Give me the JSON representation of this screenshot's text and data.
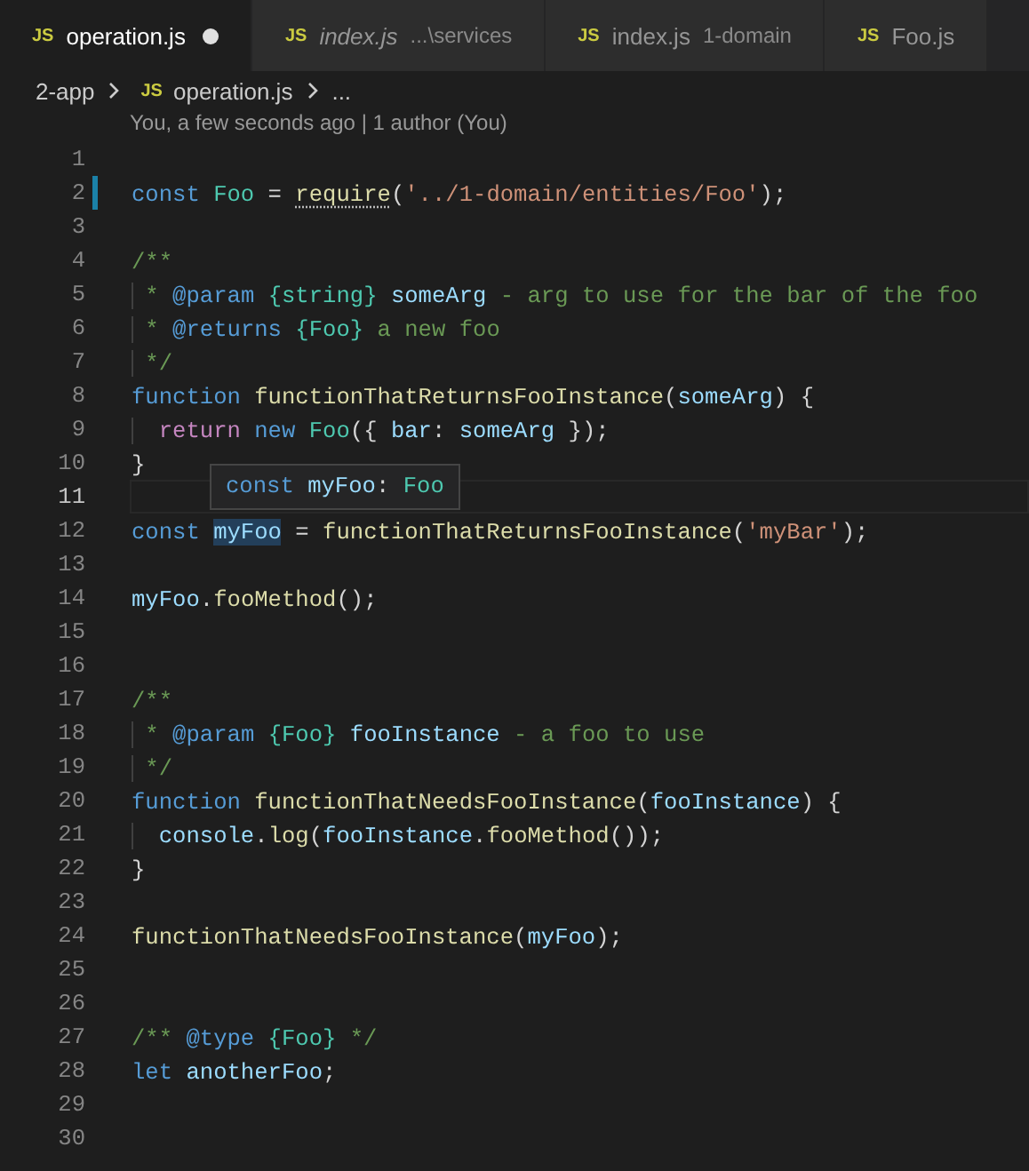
{
  "tabs": [
    {
      "icon": "JS",
      "label": "operation.js",
      "kind": "pinned",
      "selected": true,
      "dirty": true
    },
    {
      "icon": "JS",
      "label": "index.js",
      "description": "...\\services",
      "kind": "preview",
      "selected": false,
      "dirty": false
    },
    {
      "icon": "JS",
      "label": "index.js",
      "description": "1-domain",
      "kind": "pinned",
      "selected": false,
      "dirty": false
    },
    {
      "icon": "JS",
      "label": "Foo.js",
      "kind": "pinned",
      "selected": false,
      "dirty": false
    }
  ],
  "breadcrumb": [
    {
      "kind": "folder",
      "label": "2-app"
    },
    {
      "kind": "file",
      "icon": "JS",
      "label": "operation.js"
    },
    {
      "kind": "more",
      "label": "..."
    }
  ],
  "codelens": "You, a few seconds ago | 1 author (You)",
  "lines": [
    {
      "number": "1",
      "modified": false,
      "current": false
    },
    {
      "number": "2",
      "modified": true,
      "current": false,
      "tokens": [
        {
          "text": "const ",
          "kind": "keyword"
        },
        {
          "text": "Foo",
          "kind": "type"
        },
        {
          "text": " = ",
          "kind": "plain"
        },
        {
          "text": "require",
          "kind": "function",
          "suggestion": true
        },
        {
          "text": "(",
          "kind": "plain"
        },
        {
          "text": "'../1-domain/entities/Foo'",
          "kind": "string"
        },
        {
          "text": ");",
          "kind": "plain"
        }
      ]
    },
    {
      "number": "3",
      "modified": false,
      "current": false
    },
    {
      "number": "4",
      "modified": false,
      "current": false,
      "tokens": [
        {
          "text": "/**",
          "kind": "comment"
        }
      ]
    },
    {
      "number": "5",
      "modified": false,
      "current": false,
      "tokens": [
        {
          "text": " * ",
          "kind": "comment"
        },
        {
          "text": "@param ",
          "kind": "tag"
        },
        {
          "text": "{string} ",
          "kind": "type"
        },
        {
          "text": "someArg",
          "kind": "variable"
        },
        {
          "text": " - arg to use for the bar of the foo",
          "kind": "comment"
        }
      ]
    },
    {
      "number": "6",
      "modified": false,
      "current": false,
      "tokens": [
        {
          "text": " * ",
          "kind": "comment"
        },
        {
          "text": "@returns ",
          "kind": "tag"
        },
        {
          "text": "{Foo}",
          "kind": "type"
        },
        {
          "text": " a new foo",
          "kind": "comment"
        }
      ]
    },
    {
      "number": "7",
      "modified": false,
      "current": false,
      "tokens": [
        {
          "text": " */",
          "kind": "comment"
        }
      ]
    },
    {
      "number": "8",
      "modified": false,
      "current": false,
      "tokens": [
        {
          "text": "function ",
          "kind": "keyword"
        },
        {
          "text": "functionThatReturnsFooInstance",
          "kind": "function"
        },
        {
          "text": "(",
          "kind": "plain"
        },
        {
          "text": "someArg",
          "kind": "variable"
        },
        {
          "text": ") {",
          "kind": "plain"
        }
      ]
    },
    {
      "number": "9",
      "modified": false,
      "current": false,
      "tokens": [
        {
          "text": "  return ",
          "kind": "control"
        },
        {
          "text": "new ",
          "kind": "keyword"
        },
        {
          "text": "Foo",
          "kind": "type"
        },
        {
          "text": "({ ",
          "kind": "plain"
        },
        {
          "text": "bar",
          "kind": "variable"
        },
        {
          "text": ": ",
          "kind": "plain"
        },
        {
          "text": "someArg",
          "kind": "variable"
        },
        {
          "text": " });",
          "kind": "plain"
        }
      ]
    },
    {
      "number": "10",
      "modified": false,
      "current": false,
      "tokens": [
        {
          "text": "}",
          "kind": "plain"
        }
      ]
    },
    {
      "number": "11",
      "modified": false,
      "current": true,
      "hover": [
        {
          "text": "const ",
          "kind": "keyword"
        },
        {
          "text": "myFoo",
          "kind": "variable"
        },
        {
          "text": ": ",
          "kind": "plain"
        },
        {
          "text": "Foo",
          "kind": "type"
        }
      ]
    },
    {
      "number": "12",
      "modified": false,
      "current": false,
      "tokens": [
        {
          "text": "const ",
          "kind": "keyword"
        },
        {
          "text": "myFoo",
          "kind": "variable",
          "highlighted": true
        },
        {
          "text": " = ",
          "kind": "plain"
        },
        {
          "text": "functionThatReturnsFooInstance",
          "kind": "function"
        },
        {
          "text": "(",
          "kind": "plain"
        },
        {
          "text": "'myBar'",
          "kind": "string"
        },
        {
          "text": ");",
          "kind": "plain"
        }
      ]
    },
    {
      "number": "13",
      "modified": false,
      "current": false
    },
    {
      "number": "14",
      "modified": false,
      "current": false,
      "tokens": [
        {
          "text": "myFoo",
          "kind": "variable"
        },
        {
          "text": ".",
          "kind": "plain"
        },
        {
          "text": "fooMethod",
          "kind": "function"
        },
        {
          "text": "();",
          "kind": "plain"
        }
      ]
    },
    {
      "number": "15",
      "modified": false,
      "current": false
    },
    {
      "number": "16",
      "modified": false,
      "current": false
    },
    {
      "number": "17",
      "modified": false,
      "current": false,
      "tokens": [
        {
          "text": "/**",
          "kind": "comment"
        }
      ]
    },
    {
      "number": "18",
      "modified": false,
      "current": false,
      "tokens": [
        {
          "text": " * ",
          "kind": "comment"
        },
        {
          "text": "@param ",
          "kind": "tag"
        },
        {
          "text": "{Foo} ",
          "kind": "type"
        },
        {
          "text": "fooInstance",
          "kind": "variable"
        },
        {
          "text": " - a foo to use",
          "kind": "comment"
        }
      ]
    },
    {
      "number": "19",
      "modified": false,
      "current": false,
      "tokens": [
        {
          "text": " */",
          "kind": "comment"
        }
      ]
    },
    {
      "number": "20",
      "modified": false,
      "current": false,
      "tokens": [
        {
          "text": "function ",
          "kind": "keyword"
        },
        {
          "text": "functionThatNeedsFooInstance",
          "kind": "function"
        },
        {
          "text": "(",
          "kind": "plain"
        },
        {
          "text": "fooInstance",
          "kind": "variable"
        },
        {
          "text": ") {",
          "kind": "plain"
        }
      ]
    },
    {
      "number": "21",
      "modified": false,
      "current": false,
      "tokens": [
        {
          "text": "  console",
          "kind": "variable"
        },
        {
          "text": ".",
          "kind": "plain"
        },
        {
          "text": "log",
          "kind": "function"
        },
        {
          "text": "(",
          "kind": "plain"
        },
        {
          "text": "fooInstance",
          "kind": "variable"
        },
        {
          "text": ".",
          "kind": "plain"
        },
        {
          "text": "fooMethod",
          "kind": "function"
        },
        {
          "text": "());",
          "kind": "plain"
        }
      ]
    },
    {
      "number": "22",
      "modified": false,
      "current": false,
      "tokens": [
        {
          "text": "}",
          "kind": "plain"
        }
      ]
    },
    {
      "number": "23",
      "modified": false,
      "current": false
    },
    {
      "number": "24",
      "modified": false,
      "current": false,
      "tokens": [
        {
          "text": "functionThatNeedsFooInstance",
          "kind": "function"
        },
        {
          "text": "(",
          "kind": "plain"
        },
        {
          "text": "myFoo",
          "kind": "variable"
        },
        {
          "text": ");",
          "kind": "plain"
        }
      ]
    },
    {
      "number": "25",
      "modified": false,
      "current": false
    },
    {
      "number": "26",
      "modified": false,
      "current": false
    },
    {
      "number": "27",
      "modified": false,
      "current": false,
      "tokens": [
        {
          "text": "/** ",
          "kind": "comment"
        },
        {
          "text": "@type ",
          "kind": "tag"
        },
        {
          "text": "{Foo}",
          "kind": "type"
        },
        {
          "text": " */",
          "kind": "comment"
        }
      ]
    },
    {
      "number": "28",
      "modified": false,
      "current": false,
      "tokens": [
        {
          "text": "let ",
          "kind": "keyword"
        },
        {
          "text": "anotherFoo",
          "kind": "variable"
        },
        {
          "text": ";",
          "kind": "plain"
        }
      ]
    },
    {
      "number": "29",
      "modified": false,
      "current": false
    },
    {
      "number": "30",
      "modified": false,
      "current": false
    }
  ]
}
